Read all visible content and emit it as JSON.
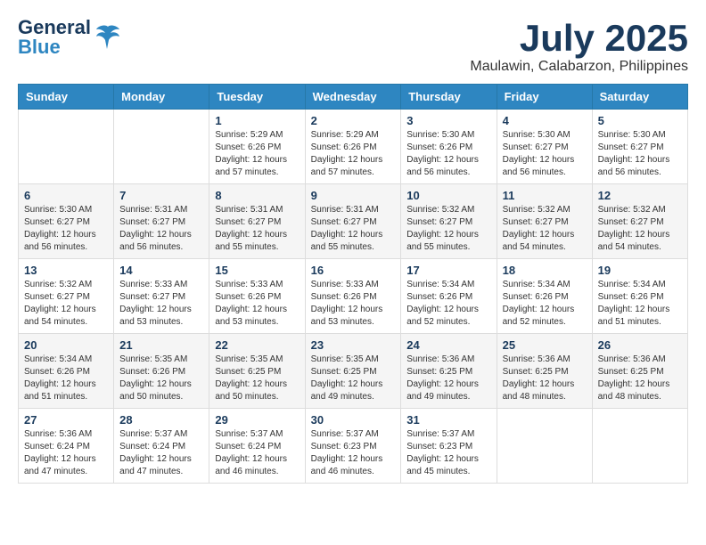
{
  "header": {
    "logo_line1": "General",
    "logo_line2": "Blue",
    "month_year": "July 2025",
    "location": "Maulawin, Calabarzon, Philippines"
  },
  "weekdays": [
    "Sunday",
    "Monday",
    "Tuesday",
    "Wednesday",
    "Thursday",
    "Friday",
    "Saturday"
  ],
  "weeks": [
    [
      null,
      null,
      {
        "day": 1,
        "sunrise": "5:29 AM",
        "sunset": "6:26 PM",
        "daylight": "12 hours and 57 minutes."
      },
      {
        "day": 2,
        "sunrise": "5:29 AM",
        "sunset": "6:26 PM",
        "daylight": "12 hours and 57 minutes."
      },
      {
        "day": 3,
        "sunrise": "5:30 AM",
        "sunset": "6:26 PM",
        "daylight": "12 hours and 56 minutes."
      },
      {
        "day": 4,
        "sunrise": "5:30 AM",
        "sunset": "6:27 PM",
        "daylight": "12 hours and 56 minutes."
      },
      {
        "day": 5,
        "sunrise": "5:30 AM",
        "sunset": "6:27 PM",
        "daylight": "12 hours and 56 minutes."
      }
    ],
    [
      {
        "day": 6,
        "sunrise": "5:30 AM",
        "sunset": "6:27 PM",
        "daylight": "12 hours and 56 minutes."
      },
      {
        "day": 7,
        "sunrise": "5:31 AM",
        "sunset": "6:27 PM",
        "daylight": "12 hours and 56 minutes."
      },
      {
        "day": 8,
        "sunrise": "5:31 AM",
        "sunset": "6:27 PM",
        "daylight": "12 hours and 55 minutes."
      },
      {
        "day": 9,
        "sunrise": "5:31 AM",
        "sunset": "6:27 PM",
        "daylight": "12 hours and 55 minutes."
      },
      {
        "day": 10,
        "sunrise": "5:32 AM",
        "sunset": "6:27 PM",
        "daylight": "12 hours and 55 minutes."
      },
      {
        "day": 11,
        "sunrise": "5:32 AM",
        "sunset": "6:27 PM",
        "daylight": "12 hours and 54 minutes."
      },
      {
        "day": 12,
        "sunrise": "5:32 AM",
        "sunset": "6:27 PM",
        "daylight": "12 hours and 54 minutes."
      }
    ],
    [
      {
        "day": 13,
        "sunrise": "5:32 AM",
        "sunset": "6:27 PM",
        "daylight": "12 hours and 54 minutes."
      },
      {
        "day": 14,
        "sunrise": "5:33 AM",
        "sunset": "6:27 PM",
        "daylight": "12 hours and 53 minutes."
      },
      {
        "day": 15,
        "sunrise": "5:33 AM",
        "sunset": "6:26 PM",
        "daylight": "12 hours and 53 minutes."
      },
      {
        "day": 16,
        "sunrise": "5:33 AM",
        "sunset": "6:26 PM",
        "daylight": "12 hours and 53 minutes."
      },
      {
        "day": 17,
        "sunrise": "5:34 AM",
        "sunset": "6:26 PM",
        "daylight": "12 hours and 52 minutes."
      },
      {
        "day": 18,
        "sunrise": "5:34 AM",
        "sunset": "6:26 PM",
        "daylight": "12 hours and 52 minutes."
      },
      {
        "day": 19,
        "sunrise": "5:34 AM",
        "sunset": "6:26 PM",
        "daylight": "12 hours and 51 minutes."
      }
    ],
    [
      {
        "day": 20,
        "sunrise": "5:34 AM",
        "sunset": "6:26 PM",
        "daylight": "12 hours and 51 minutes."
      },
      {
        "day": 21,
        "sunrise": "5:35 AM",
        "sunset": "6:26 PM",
        "daylight": "12 hours and 50 minutes."
      },
      {
        "day": 22,
        "sunrise": "5:35 AM",
        "sunset": "6:25 PM",
        "daylight": "12 hours and 50 minutes."
      },
      {
        "day": 23,
        "sunrise": "5:35 AM",
        "sunset": "6:25 PM",
        "daylight": "12 hours and 49 minutes."
      },
      {
        "day": 24,
        "sunrise": "5:36 AM",
        "sunset": "6:25 PM",
        "daylight": "12 hours and 49 minutes."
      },
      {
        "day": 25,
        "sunrise": "5:36 AM",
        "sunset": "6:25 PM",
        "daylight": "12 hours and 48 minutes."
      },
      {
        "day": 26,
        "sunrise": "5:36 AM",
        "sunset": "6:25 PM",
        "daylight": "12 hours and 48 minutes."
      }
    ],
    [
      {
        "day": 27,
        "sunrise": "5:36 AM",
        "sunset": "6:24 PM",
        "daylight": "12 hours and 47 minutes."
      },
      {
        "day": 28,
        "sunrise": "5:37 AM",
        "sunset": "6:24 PM",
        "daylight": "12 hours and 47 minutes."
      },
      {
        "day": 29,
        "sunrise": "5:37 AM",
        "sunset": "6:24 PM",
        "daylight": "12 hours and 46 minutes."
      },
      {
        "day": 30,
        "sunrise": "5:37 AM",
        "sunset": "6:23 PM",
        "daylight": "12 hours and 46 minutes."
      },
      {
        "day": 31,
        "sunrise": "5:37 AM",
        "sunset": "6:23 PM",
        "daylight": "12 hours and 45 minutes."
      },
      null,
      null
    ]
  ]
}
